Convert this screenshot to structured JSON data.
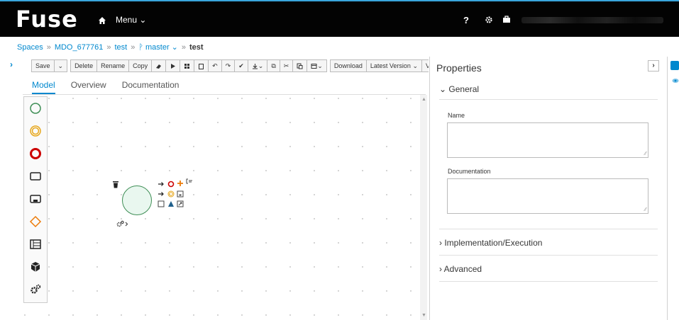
{
  "masthead": {
    "brand": "Fuse",
    "menu_label": "Menu",
    "help_label": "?"
  },
  "breadcrumb": {
    "items": [
      "Spaces",
      "MDO_677761",
      "test",
      "master",
      "test"
    ]
  },
  "toolbar": {
    "save": "Save",
    "delete": "Delete",
    "rename": "Rename",
    "copy": "Copy",
    "download": "Download",
    "latest_version": "Latest Version",
    "view": "View A"
  },
  "tabs": {
    "model": "Model",
    "overview": "Overview",
    "documentation": "Documentation"
  },
  "palette": {
    "items": [
      "start-event-icon",
      "intermediate-event-icon",
      "end-event-icon",
      "task-icon",
      "subprocess-icon",
      "gateway-icon",
      "lane-icon",
      "custom-task-icon",
      "service-tasks-icon"
    ]
  },
  "properties": {
    "title": "Properties",
    "general": "General",
    "name_label": "Name",
    "name_value": "",
    "documentation_label": "Documentation",
    "documentation_value": "",
    "implementation": "Implementation/Execution",
    "advanced": "Advanced"
  },
  "colors": {
    "accent": "#0088ce",
    "masthead": "#030303",
    "start_event": "#3e8e55",
    "intermediate_event": "#e7a71c",
    "end_event": "#cc0000",
    "gateway": "#ec7a08"
  }
}
